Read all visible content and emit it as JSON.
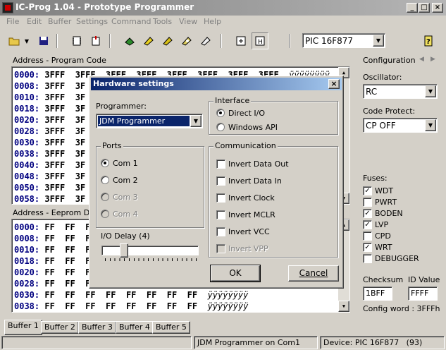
{
  "window": {
    "title": "IC-Prog 1.04 - Prototype Programmer",
    "min": "_",
    "max": "□",
    "close": "×"
  },
  "menu": [
    "File",
    "Edit",
    "Buffer",
    "Settings",
    "Command",
    "Tools",
    "View",
    "Help"
  ],
  "toolbar": {
    "device": "PIC 16F877"
  },
  "program_code": {
    "label": "Address - Program Code",
    "rows": [
      {
        "addr": "0000:",
        "data": "3FFF  3FFF  3FFF  3FFF  3FFF  3FFF  3FFF  3FFF",
        "ascii": "ÿÿÿÿÿÿÿÿ"
      },
      {
        "addr": "0008:",
        "data": "3FFF  3F"
      },
      {
        "addr": "0010:",
        "data": "3FFF  3F"
      },
      {
        "addr": "0018:",
        "data": "3FFF  3F"
      },
      {
        "addr": "0020:",
        "data": "3FFF  3F"
      },
      {
        "addr": "0028:",
        "data": "3FFF  3F"
      },
      {
        "addr": "0030:",
        "data": "3FFF  3F"
      },
      {
        "addr": "0038:",
        "data": "3FFF  3F"
      },
      {
        "addr": "0040:",
        "data": "3FFF  3F"
      },
      {
        "addr": "0048:",
        "data": "3FFF  3F"
      },
      {
        "addr": "0050:",
        "data": "3FFF  3F"
      },
      {
        "addr": "0058:",
        "data": "3FFF  3F"
      }
    ]
  },
  "eeprom": {
    "label": "Address - Eeprom Dat",
    "rows": [
      {
        "addr": "0000:",
        "data": "FF  FF  F"
      },
      {
        "addr": "0008:",
        "data": "FF  FF  F"
      },
      {
        "addr": "0010:",
        "data": "FF  FF  F"
      },
      {
        "addr": "0018:",
        "data": "FF  FF  F"
      },
      {
        "addr": "0020:",
        "data": "FF  FF  F"
      },
      {
        "addr": "0028:",
        "data": "FF  FF  F"
      },
      {
        "addr": "0030:",
        "data": "FF  FF  FF  FF  FF  FF  FF  FF",
        "ascii": "ÿÿÿÿÿÿÿÿ"
      },
      {
        "addr": "0038:",
        "data": "FF  FF  FF  FF  FF  FF  FF  FF",
        "ascii": "ÿÿÿÿÿÿÿÿ"
      }
    ]
  },
  "config": {
    "title": "Configuration",
    "oscillator_label": "Oscillator:",
    "oscillator": "RC",
    "code_protect_label": "Code Protect:",
    "code_protect": "CP OFF",
    "fuses_label": "Fuses:",
    "fuses": [
      {
        "name": "WDT",
        "checked": true
      },
      {
        "name": "PWRT",
        "checked": false
      },
      {
        "name": "BODEN",
        "checked": true
      },
      {
        "name": "LVP",
        "checked": true
      },
      {
        "name": "CPD",
        "checked": false
      },
      {
        "name": "WRT",
        "checked": true
      },
      {
        "name": "DEBUGGER",
        "checked": false
      }
    ],
    "checksum_label": "Checksum",
    "checksum": "1BFF",
    "id_label": "ID Value",
    "id_value": "FFFF",
    "config_word": "Config word : 3FFFh"
  },
  "tabs": [
    "Buffer 1",
    "Buffer 2",
    "Buffer 3",
    "Buffer 4",
    "Buffer 5"
  ],
  "status": {
    "programmer": "JDM Programmer on Com1",
    "device": "Device: PIC 16F877   (93)"
  },
  "dialog": {
    "title": "Hardware settings",
    "close": "×",
    "programmer_label": "Programmer:",
    "programmer": "JDM Programmer",
    "ports_title": "Ports",
    "ports": [
      {
        "label": "Com 1",
        "selected": true,
        "enabled": true
      },
      {
        "label": "Com 2",
        "selected": false,
        "enabled": true
      },
      {
        "label": "Com 3",
        "selected": false,
        "enabled": false
      },
      {
        "label": "Com 4",
        "selected": false,
        "enabled": false
      }
    ],
    "io_delay_label": "I/O Delay (4)",
    "io_delay_value": 4,
    "interface_title": "Interface",
    "interfaces": [
      {
        "label": "Direct I/O",
        "selected": true
      },
      {
        "label": "Windows API",
        "selected": false
      }
    ],
    "communication_title": "Communication",
    "communication": [
      {
        "label": "Invert Data Out",
        "enabled": true
      },
      {
        "label": "Invert Data In",
        "enabled": true
      },
      {
        "label": "Invert Clock",
        "enabled": true
      },
      {
        "label": "Invert MCLR",
        "enabled": true
      },
      {
        "label": "Invert VCC",
        "enabled": true
      },
      {
        "label": "Invert VPP",
        "enabled": false
      }
    ],
    "ok": "OK",
    "cancel": "Cancel"
  }
}
